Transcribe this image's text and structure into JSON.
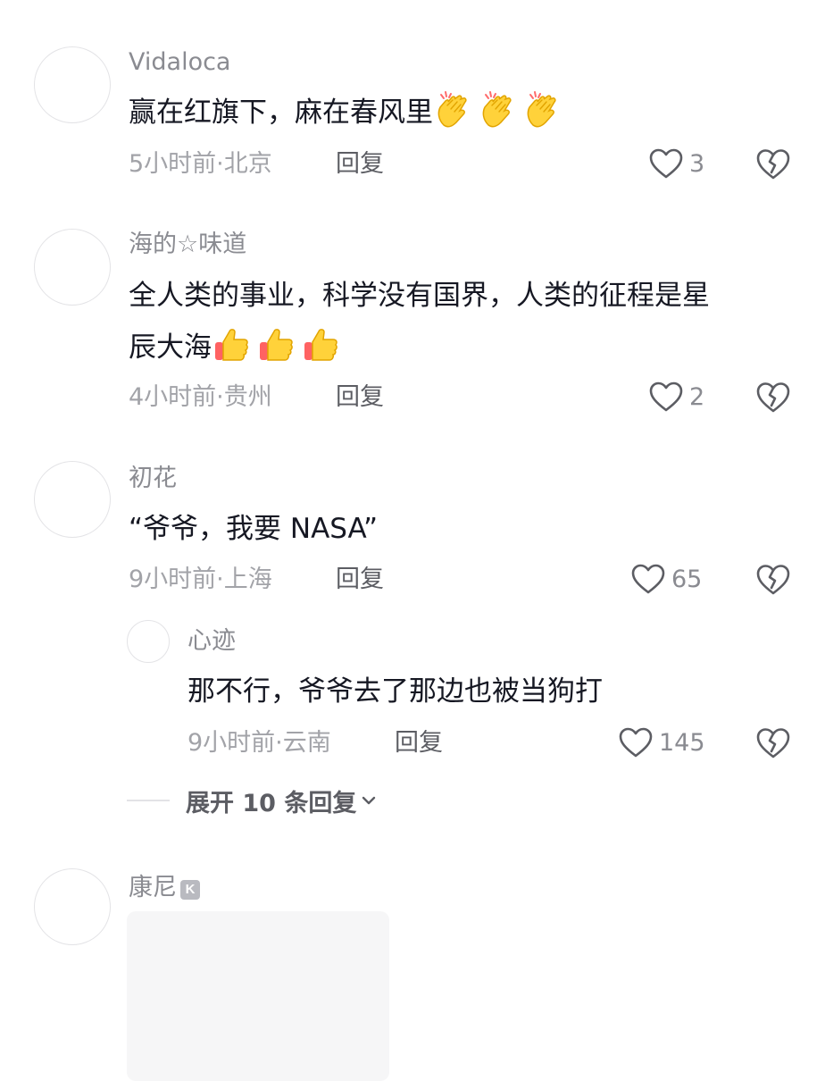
{
  "comments": [
    {
      "username": "Vidaloca",
      "text": "赢在红旗下，麻在春风里",
      "emojis": [
        "clapping-hands",
        "clapping-hands",
        "clapping-hands"
      ],
      "meta": "5小时前·北京",
      "reply_label": "回复",
      "likes": "3"
    },
    {
      "username": "海的☆味道",
      "text_line1": "全人类的事业，科学没有国界，人类的征程是星",
      "text_line2": "辰大海",
      "emojis": [
        "thumbs-up",
        "thumbs-up",
        "thumbs-up"
      ],
      "meta": "4小时前·贵州",
      "reply_label": "回复",
      "likes": "2"
    },
    {
      "username": "初花",
      "text": "“爷爷，我要 NASA”",
      "meta": "9小时前·上海",
      "reply_label": "回复",
      "likes": "65",
      "reply": {
        "username": "心迹",
        "text": "那不行，爷爷去了那边也被当狗打",
        "meta": "9小时前·云南",
        "reply_label": "回复",
        "likes": "145"
      },
      "expand_label": "展开 10 条回复"
    },
    {
      "username": "康尼",
      "badge": "K"
    }
  ],
  "icons": {
    "like": "heart-outline-icon",
    "dislike": "broken-heart-icon",
    "expand": "chevron-down-icon"
  },
  "colors": {
    "text_primary": "#161823",
    "text_secondary": "#8a8b91",
    "meta": "#a2a3a8",
    "reply": "#5c5d63",
    "divider": "#e3e3e6"
  }
}
